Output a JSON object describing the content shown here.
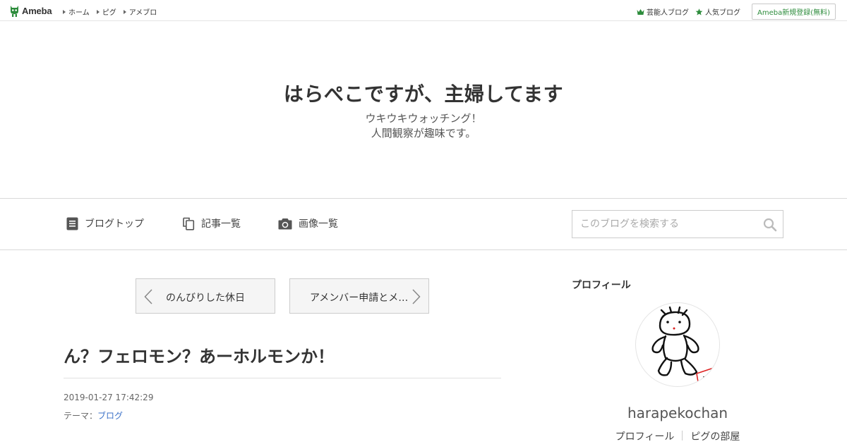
{
  "topbar": {
    "logo_text": "Ameba",
    "nav": [
      {
        "label": "ホーム"
      },
      {
        "label": "ピグ"
      },
      {
        "label": "アメブロ"
      }
    ],
    "right_links": [
      {
        "label": "芸能人ブログ",
        "icon": "crown-icon"
      },
      {
        "label": "人気ブログ",
        "icon": "star-icon"
      }
    ],
    "signup_label": "Ameba新規登録(無料)"
  },
  "header": {
    "title": "はらぺこですが、主婦してます",
    "description_line1": "ウキウキウォッチング！",
    "description_line2": "人間観察が趣味です。"
  },
  "blognav": {
    "items": [
      {
        "label": "ブログトップ",
        "icon": "document-icon"
      },
      {
        "label": "記事一覧",
        "icon": "copy-icon"
      },
      {
        "label": "画像一覧",
        "icon": "camera-icon"
      }
    ],
    "search_placeholder": "このブログを検索する"
  },
  "pager": {
    "prev_label": "のんびりした休日",
    "next_label": "アメンバー申請とメ…"
  },
  "article": {
    "title": "ん？フェロモン？あーホルモンか！",
    "date": "2019-01-27 17:42:29",
    "theme_prefix": "テーマ：",
    "theme_label": "ブログ"
  },
  "sidebar": {
    "heading": "プロフィール",
    "username": "harapekochan",
    "links": [
      {
        "label": "プロフィール"
      },
      {
        "label": "ピグの部屋"
      }
    ]
  },
  "colors": {
    "brand_green": "#2d8c3c",
    "link_blue": "#3c72c8",
    "border": "#d9d9d9"
  }
}
